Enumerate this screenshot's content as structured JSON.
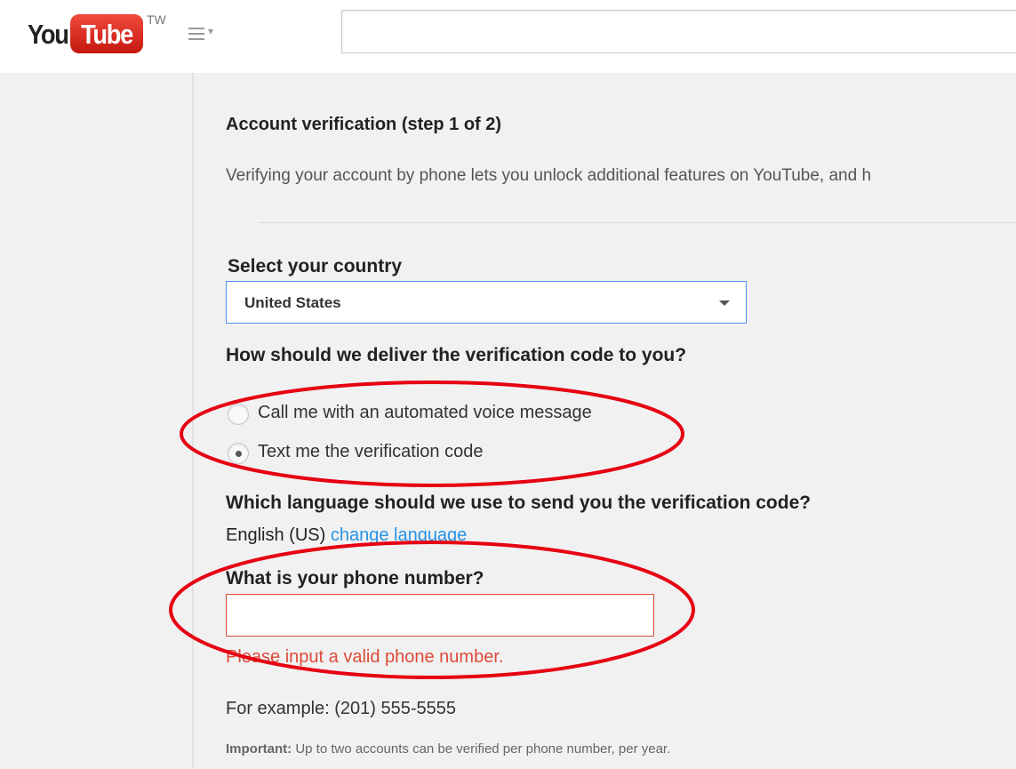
{
  "header": {
    "logo_you": "You",
    "logo_tube": "Tube",
    "logo_region": "TW",
    "search": {
      "value": "",
      "placeholder": ""
    }
  },
  "verification": {
    "step_title": "Account verification (step 1 of 2)",
    "intro": "Verifying your account by phone lets you unlock additional features on YouTube, and h",
    "country": {
      "label": "Select your country",
      "selected": "United States"
    },
    "delivery": {
      "question": "How should we deliver the verification code to you?",
      "options": [
        {
          "label": "Call me with an automated voice message",
          "checked": false
        },
        {
          "label": "Text me the verification code",
          "checked": true
        }
      ]
    },
    "language": {
      "question": "Which language should we use to send you the verification code?",
      "current": "English (US)",
      "change_link": "change language"
    },
    "phone": {
      "question": "What is your phone number?",
      "value": "",
      "error": "Please input a valid phone number.",
      "example": "For example: (201) 555-5555"
    },
    "important": {
      "label": "Important:",
      "text": "Up to two accounts can be verified per phone number, per year."
    }
  },
  "colors": {
    "annotation": "#e60012",
    "error": "#dd4b39",
    "link": "#2793e6",
    "focus_border": "#4d90fe",
    "logo_red": "#e62117"
  }
}
